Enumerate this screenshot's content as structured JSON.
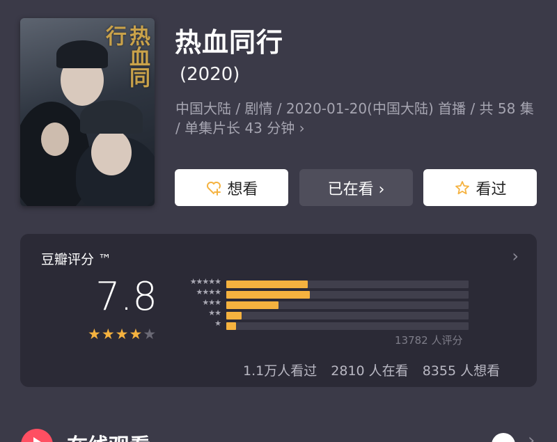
{
  "show": {
    "title": "热血同行",
    "year": "(2020)",
    "meta": "中国大陆 / 剧情 / 2020-01-20(中国大陆) 首播 / 共 58 集 / 单集片长 43 分钟 ›",
    "poster_text": "热血同行"
  },
  "actions": {
    "want": "想看",
    "watching": "已在看 ›",
    "watched": "看过"
  },
  "rating": {
    "title": "豆瓣评分 ™",
    "arrow": "›",
    "score": "7.8",
    "stars": 4,
    "distribution": [
      {
        "stars": 5,
        "label": "★★★★★",
        "fraction": 0.335
      },
      {
        "stars": 4,
        "label": "★★★★",
        "fraction": 0.345
      },
      {
        "stars": 3,
        "label": "★★★",
        "fraction": 0.215
      },
      {
        "stars": 2,
        "label": "★★",
        "fraction": 0.062
      },
      {
        "stars": 1,
        "label": "★",
        "fraction": 0.04
      }
    ],
    "count": "13782 人评分",
    "watched": "1.1万人看过",
    "watching": "2810 人在看",
    "want": "8355 人想看"
  },
  "online": {
    "title": "在线观看",
    "arrow": "›"
  },
  "colors": {
    "background": "#3b3a48",
    "card": "#2b2a36",
    "accent_star": "#f5b23f",
    "play": "#ff4f62"
  }
}
